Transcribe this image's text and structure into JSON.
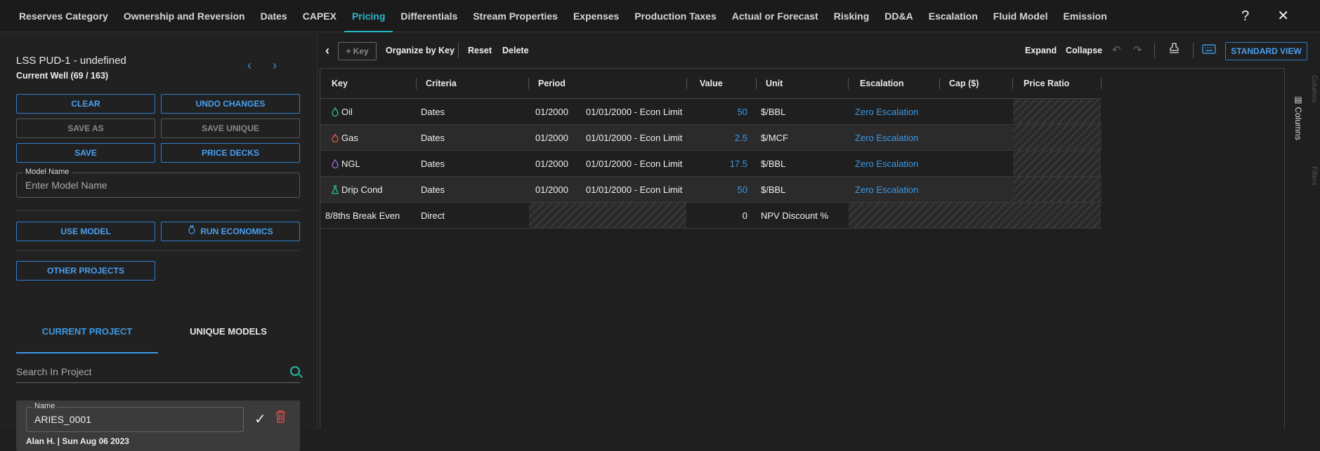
{
  "tabs": [
    "Reserves Category",
    "Ownership and Reversion",
    "Dates",
    "CAPEX",
    "Pricing",
    "Differentials",
    "Stream Properties",
    "Expenses",
    "Production Taxes",
    "Actual or Forecast",
    "Risking",
    "DD&A",
    "Escalation",
    "Fluid Model",
    "Emission"
  ],
  "active_tab": "Pricing",
  "top_icons": {
    "help": "?",
    "close": "✕"
  },
  "left": {
    "well_name": "LSS PUD-1 - undefined",
    "well_count": "Current Well (69 / 163)",
    "prev": "‹",
    "next": "›",
    "buttons": {
      "clear": "CLEAR",
      "undo": "UNDO CHANGES",
      "save_as": "SAVE AS",
      "save_unique": "SAVE UNIQUE",
      "save": "SAVE",
      "price_decks": "PRICE DECKS",
      "use_model": "USE MODEL",
      "run_economics": "RUN ECONOMICS",
      "other_projects": "OTHER PROJECTS"
    },
    "model_name_label": "Model Name",
    "model_name_placeholder": "Enter Model Name",
    "subtabs": {
      "current": "CURRENT PROJECT",
      "unique": "UNIQUE MODELS"
    },
    "search_placeholder": "Search In Project",
    "card": {
      "name_label": "Name",
      "name_value": "ARIES_0001",
      "meta": "Alan H. | Sun Aug 06 2023"
    }
  },
  "toolbar": {
    "back": "‹",
    "key": "+ Key",
    "organize": "Organize by Key",
    "reset": "Reset",
    "delete": "Delete",
    "expand": "Expand",
    "collapse": "Collapse",
    "standard_view": "STANDARD VIEW"
  },
  "grid": {
    "headers": [
      "Key",
      "Criteria",
      "Period",
      "Value",
      "Unit",
      "Escalation",
      "Cap ($)",
      "Price Ratio"
    ],
    "rows": [
      {
        "key": "Oil",
        "icon": "oil-drop-icon",
        "icon_color": "#2fbf9f",
        "criteria": "Dates",
        "period_start": "01/2000",
        "period_range": "01/01/2000 - Econ Limit",
        "value": "50",
        "unit": "$/BBL",
        "escalation": "Zero Escalation"
      },
      {
        "key": "Gas",
        "icon": "gas-flame-icon",
        "icon_color": "#e0574a",
        "criteria": "Dates",
        "period_start": "01/2000",
        "period_range": "01/01/2000 - Econ Limit",
        "value": "2.5",
        "unit": "$/MCF",
        "escalation": "Zero Escalation"
      },
      {
        "key": "NGL",
        "icon": "ngl-drop-icon",
        "icon_color": "#9a6ae0",
        "criteria": "Dates",
        "period_start": "01/2000",
        "period_range": "01/01/2000 - Econ Limit",
        "value": "17.5",
        "unit": "$/BBL",
        "escalation": "Zero Escalation"
      },
      {
        "key": "Drip Cond",
        "icon": "drip-cond-icon",
        "icon_color": "#2fbf9f",
        "criteria": "Dates",
        "period_start": "01/2000",
        "period_range": "01/01/2000 - Econ Limit",
        "value": "50",
        "unit": "$/BBL",
        "escalation": "Zero Escalation"
      },
      {
        "key": "8/8ths Break Even",
        "icon": "",
        "icon_color": "",
        "criteria": "Direct",
        "period_start": "",
        "period_range": "",
        "value": "0",
        "unit": "NPV Discount %",
        "escalation": ""
      }
    ]
  },
  "columns_label": "Columns",
  "edge_labels": {
    "columns": "Columns",
    "filters": "Filters"
  }
}
